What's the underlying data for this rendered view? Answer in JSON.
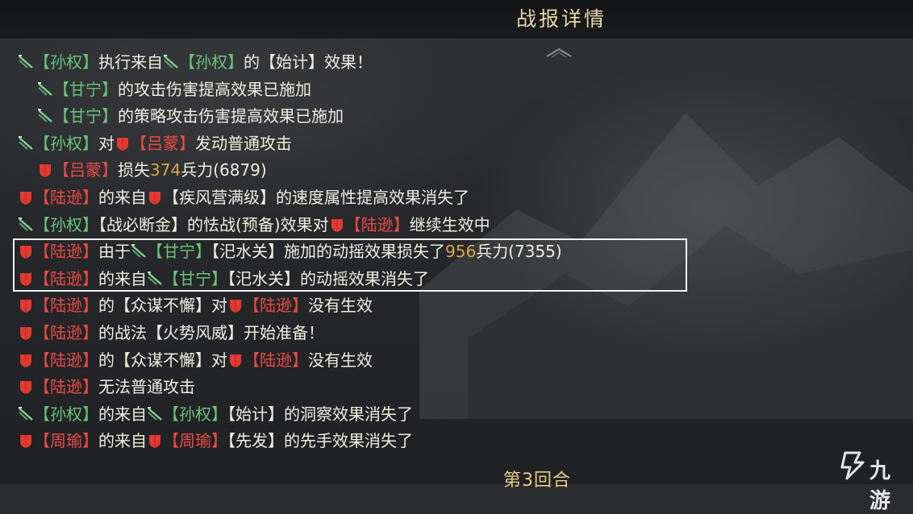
{
  "header": {
    "title": "战报详情"
  },
  "colors": {
    "ally_green": "#69c27c",
    "enemy_red": "#ec4b43",
    "number_gold": "#d8a646",
    "title_gold": "#e8d6a8"
  },
  "icons": {
    "ally": "sword-icon",
    "enemy": "shield-icon"
  },
  "log": [
    {
      "indent": 0,
      "segments": [
        {
          "icon": "sword"
        },
        {
          "text": "【孙权】",
          "color": "g"
        },
        {
          "text": "执行来自"
        },
        {
          "icon": "sword"
        },
        {
          "text": "【孙权】",
          "color": "g"
        },
        {
          "text": "的【始计】效果！"
        }
      ]
    },
    {
      "indent": 1,
      "segments": [
        {
          "icon": "sword"
        },
        {
          "text": "【甘宁】",
          "color": "g"
        },
        {
          "text": "的攻击伤害提高效果已施加"
        }
      ]
    },
    {
      "indent": 1,
      "segments": [
        {
          "icon": "sword"
        },
        {
          "text": "【甘宁】",
          "color": "g"
        },
        {
          "text": "的策略攻击伤害提高效果已施加"
        }
      ]
    },
    {
      "indent": 0,
      "segments": [
        {
          "icon": "sword"
        },
        {
          "text": "【孙权】",
          "color": "g"
        },
        {
          "text": "对"
        },
        {
          "icon": "shield"
        },
        {
          "text": "【吕蒙】",
          "color": "r"
        },
        {
          "text": "发动普通攻击"
        }
      ]
    },
    {
      "indent": 1,
      "segments": [
        {
          "icon": "shield"
        },
        {
          "text": "【吕蒙】",
          "color": "r"
        },
        {
          "text": "损失"
        },
        {
          "text": "374",
          "color": "y"
        },
        {
          "text": "兵力(6879)"
        }
      ]
    },
    {
      "indent": 0,
      "segments": [
        {
          "icon": "shield"
        },
        {
          "text": "【陆逊】",
          "color": "r"
        },
        {
          "text": "的来自"
        },
        {
          "icon": "shield"
        },
        {
          "text": "【疾风营满级】的速度属性提高效果消失了"
        }
      ]
    },
    {
      "indent": 0,
      "segments": [
        {
          "icon": "sword"
        },
        {
          "text": "【孙权】",
          "color": "g"
        },
        {
          "text": "【战必断金】的怯战(预备)效果对"
        },
        {
          "icon": "shield"
        },
        {
          "text": "【陆逊】",
          "color": "r"
        },
        {
          "text": "继续生效中"
        }
      ]
    },
    {
      "indent": 0,
      "segments": [
        {
          "icon": "shield"
        },
        {
          "text": "【陆逊】",
          "color": "r"
        },
        {
          "text": "由于"
        },
        {
          "icon": "sword"
        },
        {
          "text": "【甘宁】",
          "color": "g"
        },
        {
          "text": "【汜水关】施加的动摇效果损失了"
        },
        {
          "text": "956",
          "color": "y"
        },
        {
          "text": "兵力(7355)"
        }
      ]
    },
    {
      "indent": 0,
      "segments": [
        {
          "icon": "shield"
        },
        {
          "text": "【陆逊】",
          "color": "r"
        },
        {
          "text": "的来自"
        },
        {
          "icon": "sword"
        },
        {
          "text": "【甘宁】",
          "color": "g"
        },
        {
          "text": "【汜水关】的动摇效果消失了"
        }
      ]
    },
    {
      "indent": 0,
      "segments": [
        {
          "icon": "shield"
        },
        {
          "text": "【陆逊】",
          "color": "r"
        },
        {
          "text": "的【众谋不懈】对"
        },
        {
          "icon": "shield"
        },
        {
          "text": "【陆逊】",
          "color": "r"
        },
        {
          "text": "没有生效"
        }
      ]
    },
    {
      "indent": 0,
      "segments": [
        {
          "icon": "shield"
        },
        {
          "text": "【陆逊】",
          "color": "r"
        },
        {
          "text": "的战法【火势风威】开始准备！"
        }
      ]
    },
    {
      "indent": 0,
      "segments": [
        {
          "icon": "shield"
        },
        {
          "text": "【陆逊】",
          "color": "r"
        },
        {
          "text": "的【众谋不懈】对"
        },
        {
          "icon": "shield"
        },
        {
          "text": "【陆逊】",
          "color": "r"
        },
        {
          "text": "没有生效"
        }
      ]
    },
    {
      "indent": 0,
      "segments": [
        {
          "icon": "shield"
        },
        {
          "text": "【陆逊】",
          "color": "r"
        },
        {
          "text": "无法普通攻击"
        }
      ]
    },
    {
      "indent": 0,
      "segments": [
        {
          "icon": "sword"
        },
        {
          "text": "【孙权】",
          "color": "g"
        },
        {
          "text": "的来自"
        },
        {
          "icon": "sword"
        },
        {
          "text": "【孙权】",
          "color": "g"
        },
        {
          "text": "【始计】的洞察效果消失了"
        }
      ]
    },
    {
      "indent": 0,
      "segments": [
        {
          "icon": "shield"
        },
        {
          "text": "【周瑜】",
          "color": "r"
        },
        {
          "text": "的来自"
        },
        {
          "icon": "shield"
        },
        {
          "text": "【周瑜】",
          "color": "r"
        },
        {
          "text": "【先发】的先手效果消失了"
        }
      ]
    }
  ],
  "round_label": "第3回合",
  "watermark": "九游"
}
